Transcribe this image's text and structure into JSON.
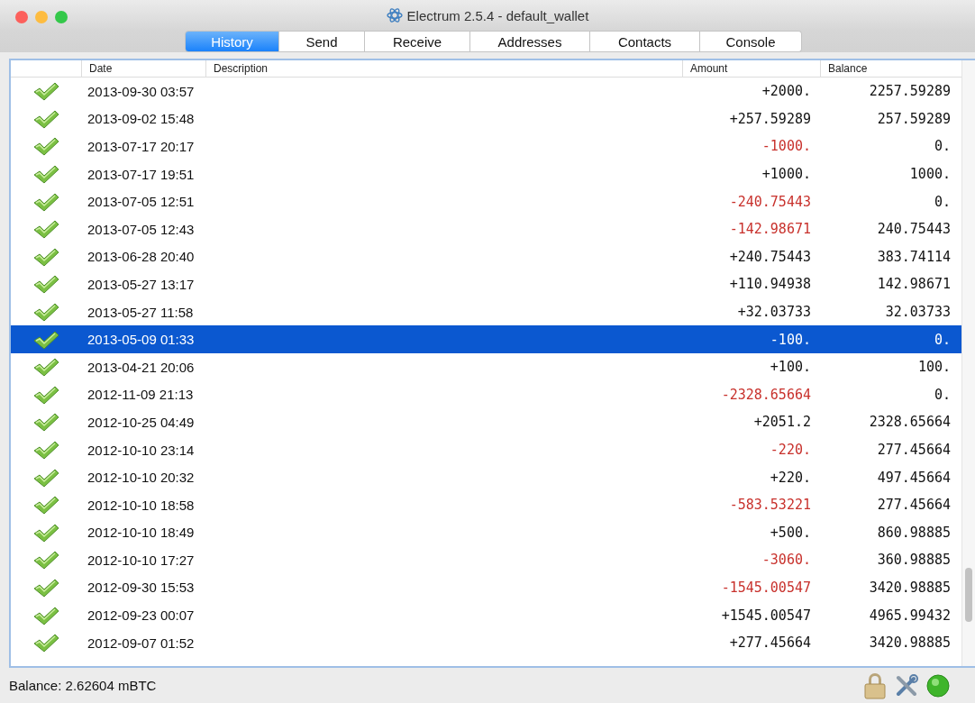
{
  "window": {
    "title": "Electrum 2.5.4  -  default_wallet"
  },
  "tabs": [
    {
      "label": "History",
      "selected": true
    },
    {
      "label": "Send",
      "selected": false
    },
    {
      "label": "Receive",
      "selected": false
    },
    {
      "label": "Addresses",
      "selected": false
    },
    {
      "label": "Contacts",
      "selected": false
    },
    {
      "label": "Console",
      "selected": false
    }
  ],
  "table": {
    "columns": [
      "Date",
      "Description",
      "Amount",
      "Balance"
    ],
    "rows": [
      {
        "date": "2013-09-30 03:57",
        "amount": "+2000.",
        "balance": "2257.59289",
        "kind": "credit",
        "selected": false
      },
      {
        "date": "2013-09-02 15:48",
        "amount": "+257.59289",
        "balance": "257.59289",
        "kind": "credit",
        "selected": false
      },
      {
        "date": "2013-07-17 20:17",
        "amount": "-1000.",
        "balance": "0.",
        "kind": "debit",
        "selected": false
      },
      {
        "date": "2013-07-17 19:51",
        "amount": "+1000.",
        "balance": "1000.",
        "kind": "credit",
        "selected": false
      },
      {
        "date": "2013-07-05 12:51",
        "amount": "-240.75443",
        "balance": "0.",
        "kind": "debit",
        "selected": false
      },
      {
        "date": "2013-07-05 12:43",
        "amount": "-142.98671",
        "balance": "240.75443",
        "kind": "debit",
        "selected": false
      },
      {
        "date": "2013-06-28 20:40",
        "amount": "+240.75443",
        "balance": "383.74114",
        "kind": "credit",
        "selected": false
      },
      {
        "date": "2013-05-27 13:17",
        "amount": "+110.94938",
        "balance": "142.98671",
        "kind": "credit",
        "selected": false
      },
      {
        "date": "2013-05-27 11:58",
        "amount": "+32.03733",
        "balance": "32.03733",
        "kind": "credit",
        "selected": false
      },
      {
        "date": "2013-05-09 01:33",
        "amount": "-100.",
        "balance": "0.",
        "kind": "debit",
        "selected": true
      },
      {
        "date": "2013-04-21 20:06",
        "amount": "+100.",
        "balance": "100.",
        "kind": "credit",
        "selected": false
      },
      {
        "date": "2012-11-09 21:13",
        "amount": "-2328.65664",
        "balance": "0.",
        "kind": "debit",
        "selected": false
      },
      {
        "date": "2012-10-25 04:49",
        "amount": "+2051.2",
        "balance": "2328.65664",
        "kind": "credit",
        "selected": false
      },
      {
        "date": "2012-10-10 23:14",
        "amount": "-220.",
        "balance": "277.45664",
        "kind": "debit",
        "selected": false
      },
      {
        "date": "2012-10-10 20:32",
        "amount": "+220.",
        "balance": "497.45664",
        "kind": "credit",
        "selected": false
      },
      {
        "date": "2012-10-10 18:58",
        "amount": "-583.53221",
        "balance": "277.45664",
        "kind": "debit",
        "selected": false
      },
      {
        "date": "2012-10-10 18:49",
        "amount": "+500.",
        "balance": "860.98885",
        "kind": "credit",
        "selected": false
      },
      {
        "date": "2012-10-10 17:27",
        "amount": "-3060.",
        "balance": "360.98885",
        "kind": "debit",
        "selected": false
      },
      {
        "date": "2012-09-30 15:53",
        "amount": "-1545.00547",
        "balance": "3420.98885",
        "kind": "debit",
        "selected": false
      },
      {
        "date": "2012-09-23 00:07",
        "amount": "+1545.00547",
        "balance": "4965.99432",
        "kind": "credit",
        "selected": false
      },
      {
        "date": "2012-09-07 01:52",
        "amount": "+277.45664",
        "balance": "3420.98885",
        "kind": "credit",
        "selected": false
      }
    ]
  },
  "status_bar": {
    "balance": "Balance: 2.62604 mBTC"
  }
}
